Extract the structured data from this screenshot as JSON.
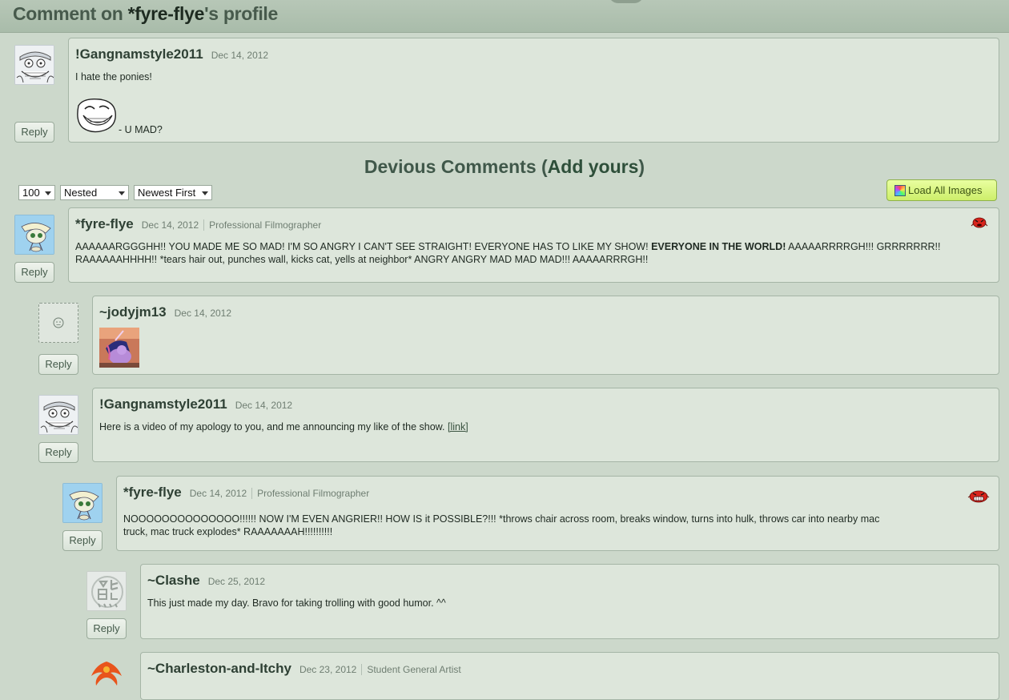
{
  "header": {
    "title_prefix": "Comment on ",
    "title_user": "*fyre-flye",
    "title_suffix": "'s profile"
  },
  "main_comment": {
    "author": "!Gangnamstyle2011",
    "date": "Dec 14, 2012",
    "line1": "I hate the ponies!",
    "line2": "- U MAD?",
    "reply_label": "Reply"
  },
  "section": {
    "title_prefix": "Devious Comments (",
    "title_link": "Add yours",
    "title_suffix": ")"
  },
  "controls": {
    "per_page": "100",
    "view_mode": "Nested",
    "sort_order": "Newest First",
    "load_images_label": "Load All Images"
  },
  "comments": [
    {
      "author": "*fyre-flye",
      "date": "Dec 14, 2012",
      "role": "Professional Filmographer",
      "line1_pre": "AAAAAARGGGHH!! YOU MADE ME SO MAD! I'M SO ANGRY I CAN'T SEE STRAIGHT! EVERYONE HAS TO LIKE MY SHOW! ",
      "line1_bold": "EVERYONE IN THE WORLD!",
      "line1_post": " AAAAARRRRGH!!! GRRRRRRR!!",
      "line2": "RAAAAAAHHHH!! *tears hair out, punches wall, kicks cat, yells at neighbor* ANGRY ANGRY MAD MAD MAD!!! AAAAARRRGH!!",
      "reply_label": "Reply"
    },
    {
      "author": "~jodyjm13",
      "date": "Dec 14, 2012",
      "reply_label": "Reply"
    },
    {
      "author": "!Gangnamstyle2011",
      "date": "Dec 14, 2012",
      "text": "Here is a video of my apology to you, and me announcing my like of the show. ",
      "link": "[link]",
      "reply_label": "Reply"
    },
    {
      "author": "*fyre-flye",
      "date": "Dec 14, 2012",
      "role": "Professional Filmographer",
      "line1": "NOOOOOOOOOOOOOO!!!!!! NOW I'M EVEN ANGRIER!! HOW IS it POSSIBLE?!!! *throws chair across room, breaks window, turns into hulk, throws car into nearby mac",
      "line2": "truck, mac truck explodes* RAAAAAAAH!!!!!!!!!!",
      "reply_label": "Reply"
    },
    {
      "author": "~Clashe",
      "date": "Dec 25, 2012",
      "text": "This just made my day. Bravo for taking trolling with good humor. ^^",
      "reply_label": "Reply"
    },
    {
      "author": "~Charleston-and-Itchy",
      "date": "Dec 23, 2012",
      "role": "Student General Artist"
    }
  ]
}
